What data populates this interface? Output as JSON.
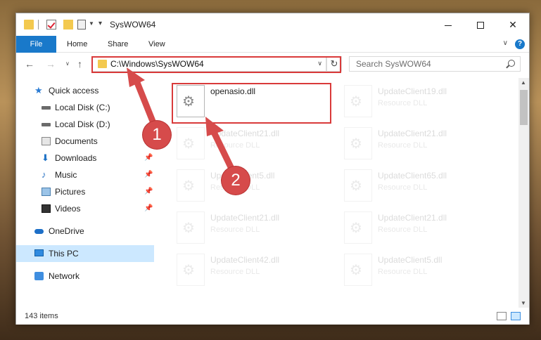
{
  "window": {
    "title": "SysWOW64",
    "controls": {
      "minimize": "–",
      "maximize": "☐",
      "close": "✕"
    }
  },
  "ribbon": {
    "tabs": [
      "File",
      "Home",
      "Share",
      "View"
    ]
  },
  "nav": {
    "back": "←",
    "forward": "→",
    "recent": "∨",
    "up": "↑",
    "address": "C:\\Windows\\SysWOW64",
    "refresh": "↻",
    "search_placeholder": "Search SysWOW64"
  },
  "sidebar": {
    "items": [
      {
        "label": "Quick access",
        "icon": "star-icon",
        "pinned": false
      },
      {
        "label": "Local Disk (C:)",
        "icon": "disk-icon",
        "pinned": false
      },
      {
        "label": "Local Disk (D:)",
        "icon": "disk-icon",
        "pinned": false
      },
      {
        "label": "Documents",
        "icon": "documents-icon",
        "pinned": true
      },
      {
        "label": "Downloads",
        "icon": "download-icon",
        "pinned": true
      },
      {
        "label": "Music",
        "icon": "music-icon",
        "pinned": true
      },
      {
        "label": "Pictures",
        "icon": "pictures-icon",
        "pinned": true
      },
      {
        "label": "Videos",
        "icon": "video-icon",
        "pinned": true
      },
      {
        "label": "OneDrive",
        "icon": "cloud-icon",
        "pinned": false
      },
      {
        "label": "This PC",
        "icon": "computer-icon",
        "pinned": false,
        "selected": true
      },
      {
        "label": "Network",
        "icon": "network-icon",
        "pinned": false
      }
    ]
  },
  "files": [
    {
      "name": "openasio.dll",
      "type": "",
      "highlighted": true
    },
    {
      "name": "UpdateClient19.dll",
      "type": "Resource DLL"
    },
    {
      "name": "UpdateClient21.dll",
      "type": "Resource DLL"
    },
    {
      "name": "UpdateClient21.dll",
      "type": "Resource DLL"
    },
    {
      "name": "UpdateClient5.dll",
      "type": "Resource DLL"
    },
    {
      "name": "UpdateClient65.dll",
      "type": "Resource DLL"
    },
    {
      "name": "UpdateClient21.dll",
      "type": "Resource DLL"
    },
    {
      "name": "UpdateClient21.dll",
      "type": "Resource DLL"
    },
    {
      "name": "UpdateClient42.dll",
      "type": "Resource DLL"
    },
    {
      "name": "UpdateClient5.dll",
      "type": "Resource DLL"
    }
  ],
  "status": {
    "item_count": "143 items"
  },
  "annotations": {
    "step1": "1",
    "step2": "2",
    "color": "#d64b4b"
  }
}
